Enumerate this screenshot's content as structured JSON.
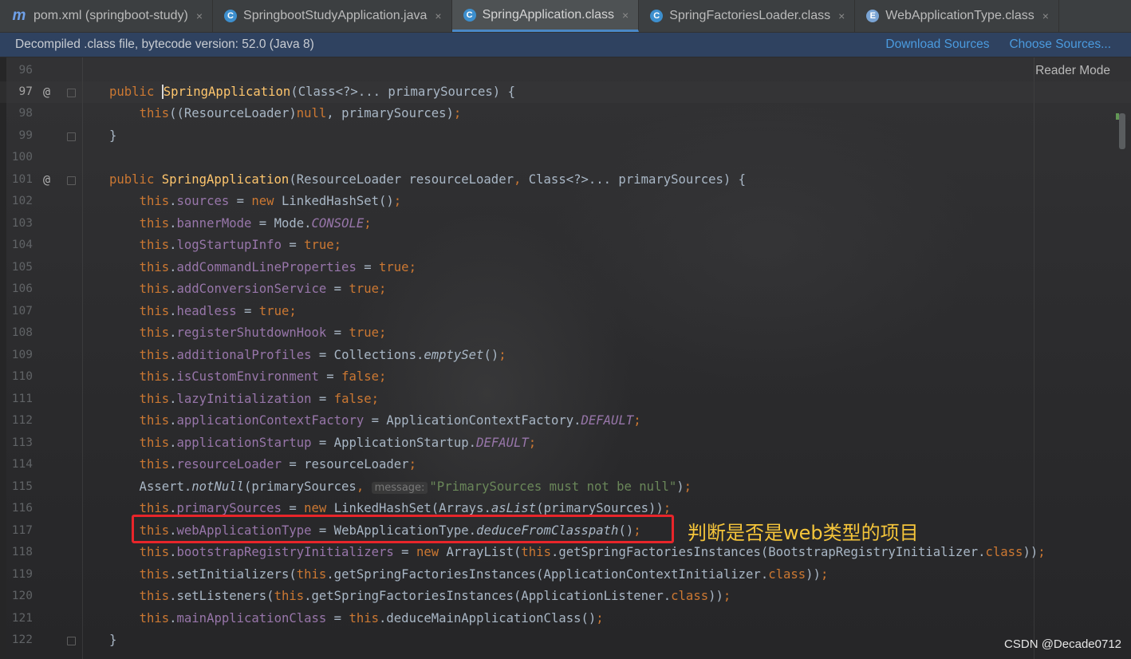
{
  "tabs": [
    {
      "label": "pom.xml (springboot-study)",
      "icon": "maven-icon",
      "glyph": "m",
      "active": false
    },
    {
      "label": "SpringbootStudyApplication.java",
      "icon": "java-class-icon",
      "glyph": "C",
      "active": false
    },
    {
      "label": "SpringApplication.class",
      "icon": "class-icon",
      "glyph": "C",
      "active": true
    },
    {
      "label": "SpringFactoriesLoader.class",
      "icon": "class-icon",
      "glyph": "C",
      "active": false
    },
    {
      "label": "WebApplicationType.class",
      "icon": "enum-icon",
      "glyph": "E",
      "active": false
    }
  ],
  "tab_close_glyph": "×",
  "banner": {
    "text": "Decompiled .class file, bytecode version: 52.0 (Java 8)",
    "download_sources": "Download Sources",
    "choose_sources": "Choose Sources..."
  },
  "editor": {
    "reader_mode": "Reader Mode",
    "current_line": 97,
    "lines": [
      {
        "n": "96"
      },
      {
        "n": "97"
      },
      {
        "n": "98"
      },
      {
        "n": "99"
      },
      {
        "n": "100"
      },
      {
        "n": "101"
      },
      {
        "n": "102"
      },
      {
        "n": "103"
      },
      {
        "n": "104"
      },
      {
        "n": "105"
      },
      {
        "n": "106"
      },
      {
        "n": "107"
      },
      {
        "n": "108"
      },
      {
        "n": "109"
      },
      {
        "n": "110"
      },
      {
        "n": "111"
      },
      {
        "n": "112"
      },
      {
        "n": "113"
      },
      {
        "n": "114"
      },
      {
        "n": "115"
      },
      {
        "n": "116"
      },
      {
        "n": "117"
      },
      {
        "n": "118"
      },
      {
        "n": "119"
      },
      {
        "n": "120"
      },
      {
        "n": "121"
      },
      {
        "n": "122"
      }
    ],
    "param_hint": "message:",
    "override_marker": "@"
  },
  "annotation": {
    "text": "判断是否是web类型的项目",
    "color": "#f5c53a",
    "box_color": "#e8252a"
  },
  "watermark": "CSDN @Decade0712",
  "colors": {
    "keyword": "#cc7832",
    "field": "#9876aa",
    "method_decl": "#ffc66d",
    "string": "#6a8759",
    "default_text": "#a9b7c6",
    "link": "#4b9bdf",
    "banner_bg": "#2f4260"
  }
}
